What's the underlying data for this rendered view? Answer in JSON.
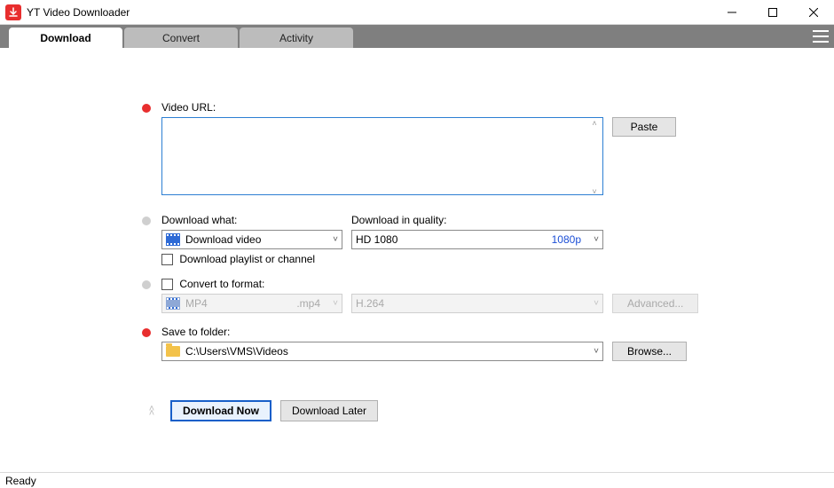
{
  "app": {
    "title": "YT Video Downloader"
  },
  "tabs": {
    "download": "Download",
    "convert": "Convert",
    "activity": "Activity"
  },
  "url": {
    "label": "Video URL:",
    "value": "",
    "paste_label": "Paste"
  },
  "download_what": {
    "label": "Download what:",
    "selected": "Download video",
    "playlist_checkbox_label": "Download playlist or channel"
  },
  "quality": {
    "label": "Download in quality:",
    "selected": "HD 1080",
    "tag": "1080p"
  },
  "convert": {
    "checkbox_label": "Convert to format:",
    "format": "MP4",
    "ext": ".mp4",
    "codec": "H.264",
    "advanced_label": "Advanced..."
  },
  "folder": {
    "label": "Save to folder:",
    "path": "C:\\Users\\VMS\\Videos",
    "browse_label": "Browse..."
  },
  "actions": {
    "download_now": "Download Now",
    "download_later": "Download Later"
  },
  "status": "Ready"
}
